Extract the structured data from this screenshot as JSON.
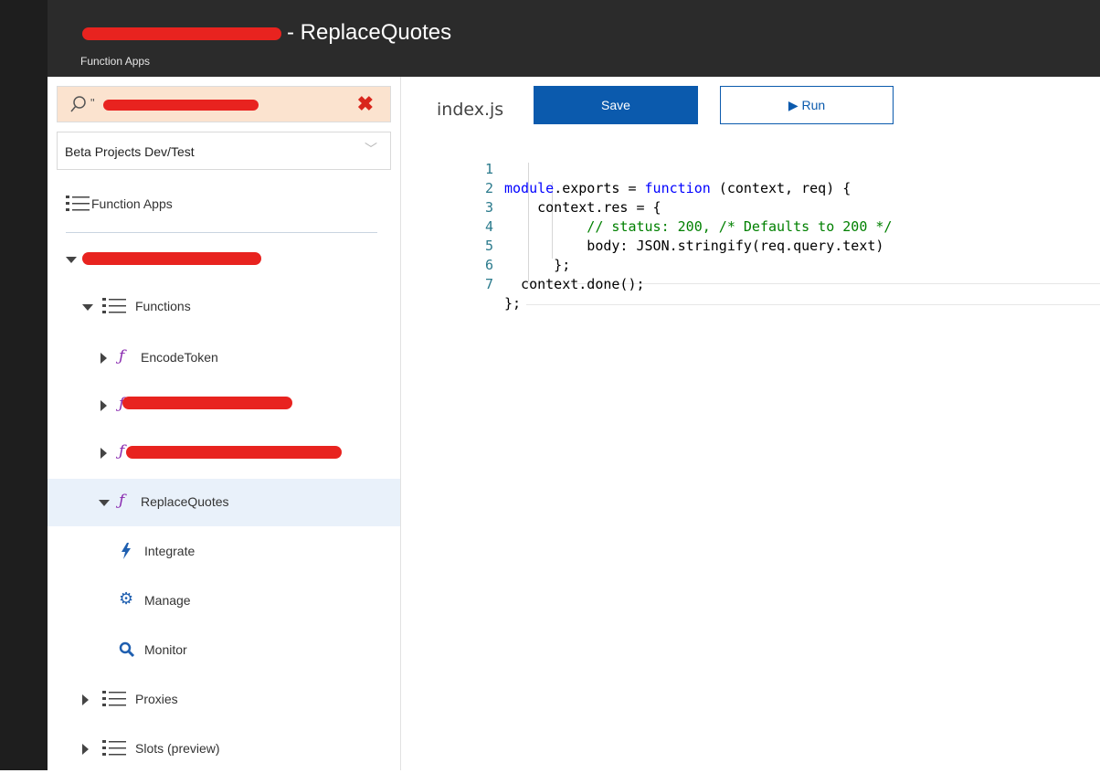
{
  "header": {
    "title_suffix": "- ReplaceQuotes",
    "subtitle": "Function Apps"
  },
  "sidebar": {
    "search_prefix": "\"",
    "subscription": "Beta Projects Dev/Test",
    "function_apps_label": "Function Apps",
    "tree": {
      "functions_label": "Functions",
      "items": [
        {
          "label": "EncodeToken"
        },
        {
          "label": "ReplaceQuotes",
          "selected": true
        }
      ],
      "children": [
        {
          "label": "Integrate",
          "icon": "lightning-icon"
        },
        {
          "label": "Manage",
          "icon": "gear-icon"
        },
        {
          "label": "Monitor",
          "icon": "search-icon"
        }
      ],
      "proxies_label": "Proxies",
      "slots_label": "Slots (preview)"
    }
  },
  "editor": {
    "filename": "index.js",
    "save_label": "Save",
    "run_label": "Run",
    "lines": [
      {
        "n": "1",
        "text": "module.exports = function (context, req) {"
      },
      {
        "n": "2",
        "text": "    context.res = {"
      },
      {
        "n": "3",
        "text": "          // status: 200, /* Defaults to 200 */"
      },
      {
        "n": "4",
        "text": "          body: JSON.stringify(req.query.text)"
      },
      {
        "n": "5",
        "text": "      };"
      },
      {
        "n": "6",
        "text": "  context.done();"
      },
      {
        "n": "7",
        "text": "};"
      }
    ]
  },
  "colors": {
    "accent": "#0b5aad",
    "header_bg": "#2b2b2b",
    "search_bg": "#fbe3cf",
    "selected_bg": "#e9f1fa",
    "function_icon": "#8a2bb0",
    "redaction": "#e8231f"
  }
}
